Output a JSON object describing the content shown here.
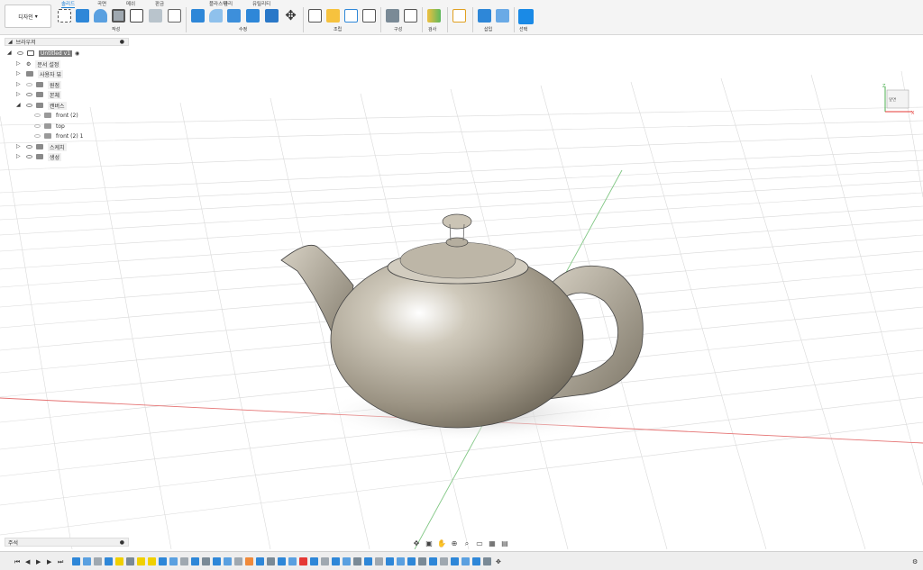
{
  "toolbar": {
    "design_button": "디자인",
    "tabs": [
      "솔리드",
      "곡면",
      "메쉬",
      "판금",
      "플라스틱",
      "관리",
      "유틸리티"
    ],
    "active_tab": "솔리드",
    "groups": [
      "작성",
      "수정",
      "조립",
      "구성",
      "검사",
      "삽입",
      "선택"
    ]
  },
  "browser": {
    "title": "브라우저",
    "items": [
      {
        "label": "Untitled v1",
        "level": 0,
        "tri": "◢"
      },
      {
        "label": "문서 설정",
        "level": 1,
        "tri": "▷"
      },
      {
        "label": "사용자 뷰",
        "level": 1,
        "tri": "▷"
      },
      {
        "label": "원점",
        "level": 1,
        "tri": "▷"
      },
      {
        "label": "본체",
        "level": 1,
        "tri": "▷"
      },
      {
        "label": "캔버스",
        "level": 1,
        "tri": "◢"
      },
      {
        "label": "front (2)",
        "level": 2,
        "tri": ""
      },
      {
        "label": "top",
        "level": 2,
        "tri": ""
      },
      {
        "label": "front (2) 1",
        "level": 2,
        "tri": ""
      },
      {
        "label": "스케치",
        "level": 1,
        "tri": "▷"
      },
      {
        "label": "생성",
        "level": 1,
        "tri": "▷"
      }
    ]
  },
  "comments": {
    "label": "주석"
  },
  "colors": {
    "accent": "#1a7fd6",
    "select_button": "#1a8ae6",
    "x_axis": "#e57373",
    "y_axis": "#81c784"
  },
  "icons": [
    "new-sketch-icon",
    "extrude-icon",
    "revolve-icon",
    "hole-icon",
    "move-icon",
    "joint-icon",
    "select-arrow-icon",
    "settings-icon",
    "orbit-icon",
    "pan-icon",
    "zoom-icon",
    "display-settings-icon",
    "grid-icon",
    "viewcube-icon"
  ]
}
